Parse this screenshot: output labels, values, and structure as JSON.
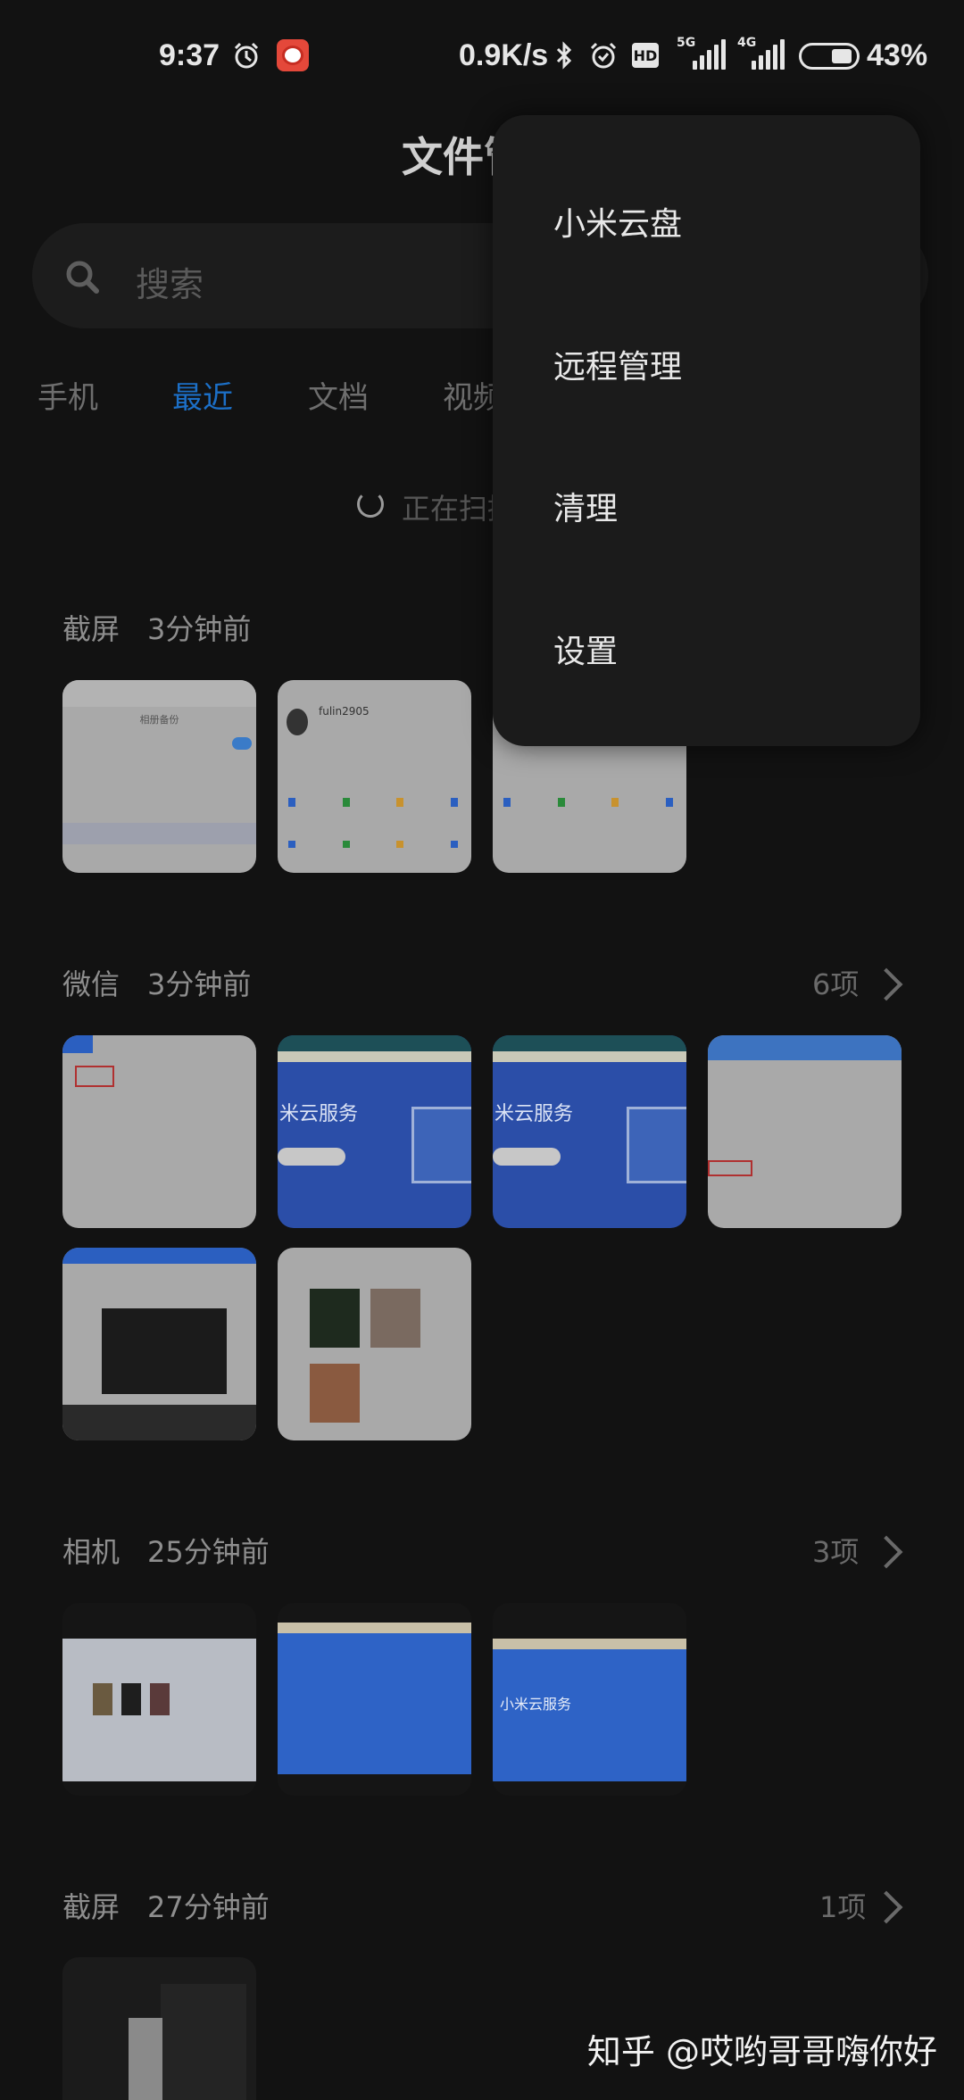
{
  "status_bar": {
    "time": "9:37",
    "net_speed": "0.9K/s",
    "hd_label": "HD",
    "sim1_label": "5G",
    "sim2_label": "4G",
    "battery_percent": "43%",
    "battery_level": 0.43,
    "icons": [
      "alarm-icon",
      "app-notification-icon",
      "bluetooth-icon",
      "alarm-icon",
      "hd-icon",
      "signal-5g-icon",
      "signal-4g-icon",
      "battery-icon"
    ]
  },
  "header": {
    "title": "文件管理",
    "search_placeholder": "搜索"
  },
  "tabs": [
    {
      "label": "手机",
      "active": false
    },
    {
      "label": "最近",
      "active": true
    },
    {
      "label": "文档",
      "active": false
    },
    {
      "label": "视频",
      "active": false
    }
  ],
  "scan_status": "正在扫描",
  "sections": [
    {
      "title": "截屏",
      "time": "3分钟前",
      "count": "",
      "thumbs": 3
    },
    {
      "title": "微信",
      "time": "3分钟前",
      "count": "6项",
      "thumbs": 6
    },
    {
      "title": "相机",
      "time": "25分钟前",
      "count": "3项",
      "thumbs": 3
    },
    {
      "title": "截屏",
      "time": "27分钟前",
      "count": "1项",
      "thumbs": 1
    }
  ],
  "thumb_captions": {
    "s0_t1": "相册备份",
    "s0_t2": "fulin2905",
    "s1_t2": "米云服务",
    "s1_t3": "米云服务",
    "s2_t3": "小米云服务"
  },
  "menu": {
    "items": [
      "小米云盘",
      "远程管理",
      "清理",
      "设置"
    ]
  },
  "watermark": "知乎 @哎哟哥哥嗨你好",
  "colors": {
    "background": "#121212",
    "accent": "#1c6fc6",
    "menu_bg": "#1b1b1b"
  }
}
